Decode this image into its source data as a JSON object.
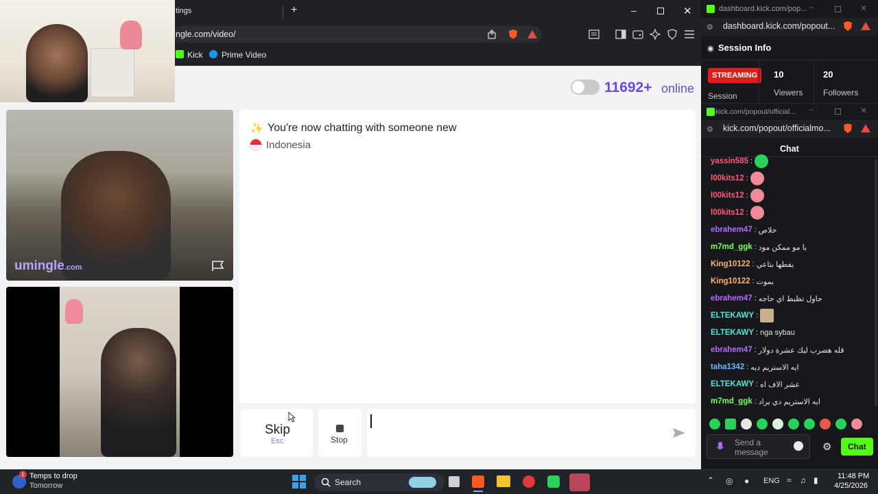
{
  "browser": {
    "tab_title": "tings",
    "url": "ngle.com/video/",
    "bookmarks": [
      "Kick",
      "Prime Video"
    ]
  },
  "header": {
    "online_count": "11692+",
    "online_label": "online"
  },
  "video": {
    "watermark_main": "umingle",
    "watermark_suffix": ".com"
  },
  "chat_panel": {
    "new_chat_message": "You're now chatting with someone new",
    "country": "Indonesia"
  },
  "controls": {
    "skip_label": "Skip",
    "skip_shortcut": "Esc",
    "stop_label": "Stop",
    "message_value": ""
  },
  "session_window": {
    "url": "dashboard.kick.com/popout...",
    "title_url": "dashboard.kick.com/pop...",
    "heading": "Session Info",
    "status_badge": "STREAMING",
    "session_label": "Session",
    "viewers_value": "10",
    "viewers_label": "Viewers",
    "followers_value": "20",
    "followers_label": "Followers"
  },
  "chat_window": {
    "title_url": "kick.com/popout/official...",
    "url": "kick.com/popout/officialmo...",
    "heading": "Chat",
    "messages": [
      {
        "user": "yassin585",
        "text": "",
        "color": "#ff5a7a"
      },
      {
        "user": "l00kits12",
        "text": "",
        "color": "#ff5a7a"
      },
      {
        "user": "l00kits12",
        "text": "",
        "color": "#ff5a7a"
      },
      {
        "user": "l00kits12",
        "text": "",
        "color": "#ff5a7a"
      },
      {
        "user": "ebrahem47",
        "text": "خلاص",
        "color": "#b36cff"
      },
      {
        "user": "m7md_ggk",
        "text": "يا مو ممكن مود",
        "color": "#7dff5b"
      },
      {
        "user": "King10122",
        "text": "يفطها بتاعي",
        "color": "#ffb36b"
      },
      {
        "user": "King10122",
        "text": "بموت",
        "color": "#ffb36b"
      },
      {
        "user": "ebrahem47",
        "text": "حاول تظبط اي حاجه",
        "color": "#b36cff"
      },
      {
        "user": "ELTEKAWY",
        "text": "",
        "color": "#4ee6d8"
      },
      {
        "user": "ELTEKAWY",
        "text": "nga sybau",
        "color": "#4ee6d8"
      },
      {
        "user": "ebrahem47",
        "text": "قله هضرب ليك عشرة دولار",
        "color": "#b36cff"
      },
      {
        "user": "taha1342",
        "text": "ايه الاستريم ديه",
        "color": "#6ab8ff"
      },
      {
        "user": "ELTEKAWY",
        "text": "عشر الاف اه",
        "color": "#4ee6d8"
      },
      {
        "user": "m7md_ggk",
        "text": "ايه الاستريم دي يراد",
        "color": "#7dff5b"
      }
    ],
    "send_placeholder_line1": "Send a",
    "send_placeholder_line2": "message",
    "chat_button": "Chat"
  },
  "taskbar": {
    "weather_line1": "Temps to drop",
    "weather_line2": "Tomorrow",
    "weather_badge": "1",
    "search_label": "Search",
    "language": "ENG",
    "time": "11:48 PM",
    "date": "4/25/2026"
  },
  "colors": {
    "accent_purple": "#6a4bd8",
    "kick_green": "#53fc18",
    "streaming_red": "#e01b1b"
  }
}
